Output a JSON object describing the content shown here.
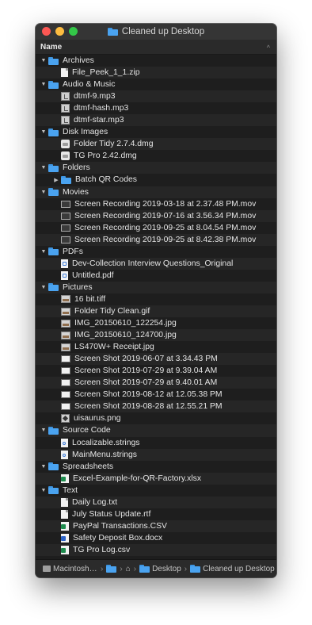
{
  "window": {
    "title": "Cleaned up Desktop",
    "traffic_lights": [
      "#fc5753",
      "#fdbc40",
      "#33c748"
    ]
  },
  "columns": {
    "name_label": "Name",
    "sort_indicator": "^"
  },
  "rows": [
    {
      "depth": 0,
      "expand": "expanded",
      "icon": "folder-icon",
      "label": "Archives"
    },
    {
      "depth": 1,
      "icon": "file-icon",
      "label": "File_Peek_1_1.zip"
    },
    {
      "depth": 0,
      "expand": "expanded",
      "icon": "folder-icon",
      "label": "Audio & Music"
    },
    {
      "depth": 1,
      "icon": "audio-icon",
      "label": "dtmf-9.mp3"
    },
    {
      "depth": 1,
      "icon": "audio-icon",
      "label": "dtmf-hash.mp3"
    },
    {
      "depth": 1,
      "icon": "audio-icon",
      "label": "dtmf-star.mp3"
    },
    {
      "depth": 0,
      "expand": "expanded",
      "icon": "folder-icon",
      "label": "Disk Images"
    },
    {
      "depth": 1,
      "icon": "dmg-icon",
      "label": "Folder Tidy 2.7.4.dmg"
    },
    {
      "depth": 1,
      "icon": "dmg-icon",
      "label": "TG Pro 2.42.dmg"
    },
    {
      "depth": 0,
      "expand": "expanded",
      "icon": "folder-icon",
      "label": "Folders"
    },
    {
      "depth": 1,
      "expand": "collapsed",
      "icon": "folder-icon",
      "label": "Batch QR Codes"
    },
    {
      "depth": 0,
      "expand": "expanded",
      "icon": "folder-icon",
      "label": "Movies"
    },
    {
      "depth": 1,
      "icon": "movie-icon",
      "label": "Screen Recording 2019-03-18 at 2.37.48 PM.mov"
    },
    {
      "depth": 1,
      "icon": "movie-icon",
      "label": "Screen Recording 2019-07-16 at 3.56.34 PM.mov"
    },
    {
      "depth": 1,
      "icon": "movie-icon",
      "label": "Screen Recording 2019-09-25 at 8.04.54 PM.mov"
    },
    {
      "depth": 1,
      "icon": "movie-icon",
      "label": "Screen Recording 2019-09-25 at 8.42.38 PM.mov"
    },
    {
      "depth": 0,
      "expand": "expanded",
      "icon": "folder-icon",
      "label": "PDFs"
    },
    {
      "depth": 1,
      "icon": "pdf-icon",
      "label": "Dev-Collection Interview Questions_Original"
    },
    {
      "depth": 1,
      "icon": "pdf-icon",
      "label": "Untitled.pdf"
    },
    {
      "depth": 0,
      "expand": "expanded",
      "icon": "folder-icon",
      "label": "Pictures"
    },
    {
      "depth": 1,
      "icon": "image-icon",
      "label": "16 bit.tiff"
    },
    {
      "depth": 1,
      "icon": "image-icon",
      "label": "Folder Tidy Clean.gif"
    },
    {
      "depth": 1,
      "icon": "image-icon",
      "label": "IMG_20150610_122254.jpg"
    },
    {
      "depth": 1,
      "icon": "image-icon",
      "label": "IMG_20150610_124700.jpg"
    },
    {
      "depth": 1,
      "icon": "image-icon",
      "label": "LS470W+ Receipt.jpg"
    },
    {
      "depth": 1,
      "icon": "shot-icon",
      "label": "Screen Shot 2019-06-07 at 3.34.43 PM"
    },
    {
      "depth": 1,
      "icon": "shot-icon",
      "label": "Screen Shot 2019-07-29 at 9.39.04 AM"
    },
    {
      "depth": 1,
      "icon": "shot-icon",
      "label": "Screen Shot 2019-07-29 at 9.40.01 AM"
    },
    {
      "depth": 1,
      "icon": "shot-icon",
      "label": "Screen Shot 2019-08-12 at 12.05.38 PM"
    },
    {
      "depth": 1,
      "icon": "shot-icon",
      "label": "Screen Shot 2019-08-28 at 12.55.21 PM"
    },
    {
      "depth": 1,
      "icon": "png-icon",
      "label": "uisaurus.png"
    },
    {
      "depth": 0,
      "expand": "expanded",
      "icon": "folder-icon",
      "label": "Source Code"
    },
    {
      "depth": 1,
      "icon": "strings-icon",
      "label": "Localizable.strings"
    },
    {
      "depth": 1,
      "icon": "strings-icon",
      "label": "MainMenu.strings"
    },
    {
      "depth": 0,
      "expand": "expanded",
      "icon": "folder-icon",
      "label": "Spreadsheets"
    },
    {
      "depth": 1,
      "icon": "xlsx-icon",
      "label": "Excel-Example-for-QR-Factory.xlsx"
    },
    {
      "depth": 0,
      "expand": "expanded",
      "icon": "folder-icon",
      "label": "Text"
    },
    {
      "depth": 1,
      "icon": "file-icon",
      "label": "Daily Log.txt"
    },
    {
      "depth": 1,
      "icon": "file-icon",
      "label": "July Status Update.rtf"
    },
    {
      "depth": 1,
      "icon": "csv-icon",
      "label": "PayPal Transactions.CSV"
    },
    {
      "depth": 1,
      "icon": "docx-icon",
      "label": "Safety Deposit Box.docx"
    },
    {
      "depth": 1,
      "icon": "csv-icon",
      "label": "TG Pro Log.csv"
    }
  ],
  "pathbar": {
    "segments": [
      {
        "icon": "hard-drive-icon",
        "label": "Macintosh HD"
      },
      {
        "icon": "folder-icon",
        "label": ""
      },
      {
        "icon": "home-icon",
        "label": ""
      },
      {
        "icon": "folder-icon",
        "label": "Desktop"
      },
      {
        "icon": "folder-icon",
        "label": "Cleaned up Desktop"
      }
    ],
    "separator": "›"
  },
  "colors": {
    "window_bg": "#1e1e1e",
    "row_alt": "#262626",
    "folder_blue": "#4aa3f0",
    "text": "#e4e4e4"
  }
}
